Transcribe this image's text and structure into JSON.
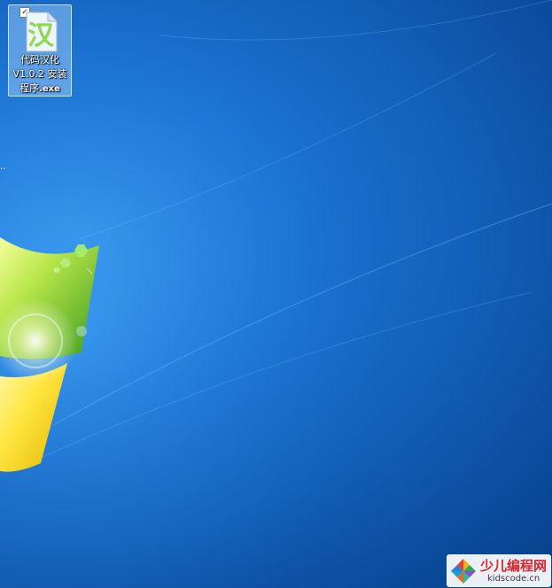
{
  "desktop": {
    "icons": [
      {
        "name_line1": "代码汉化",
        "name_line2": "V1.0.2 安装",
        "name_line3_start": "程序",
        "extension": ".exe",
        "glyph": "汉",
        "selected": true,
        "checkbox_checked": true
      }
    ],
    "stray_text": "..",
    "colors": {
      "wallpaper_blue": "#1c74d4",
      "logo_green": "#8fd84a",
      "watermark_red": "#d9262b"
    }
  },
  "watermark": {
    "title": "少儿编程网",
    "url": "kidscode.cn",
    "logo_icon": "kidscode-logo-icon"
  }
}
